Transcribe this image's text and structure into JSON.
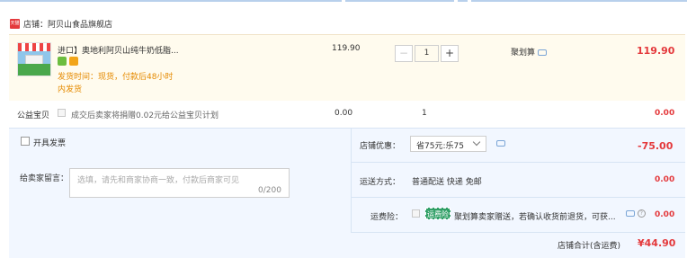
{
  "shop": {
    "badge": "天猫",
    "label": "店铺：阿贝山食品旗舰店"
  },
  "item": {
    "title": "进口】奥地利阿贝山纯牛奶低脂...",
    "ship_note_line1": "发货时间：现货，付款后48小时",
    "ship_note_line2": "内发货",
    "unit_price": "119.90",
    "quantity": "1",
    "promo": "聚划算",
    "total": "119.90"
  },
  "charity": {
    "label": "公益宝贝",
    "text": "成交后卖家将捐赠0.02元给公益宝贝计划",
    "price": "0.00",
    "qty": "1",
    "total": "0.00"
  },
  "order": {
    "invoice_label": "开具发票",
    "memo_label": "给卖家留言：",
    "memo_placeholder": "选填，请先和商家协商一致，付款后商家可见",
    "memo_count": "0/200",
    "shop_discount_label": "店铺优惠：",
    "shop_discount_value": "省75元:乐75",
    "shop_discount_amount": "-75.00",
    "shipping_label": "运送方式：",
    "shipping_value": "普通配送 快递 免邮",
    "shipping_amount": "0.00",
    "insurance_label": "运费险：",
    "insurance_badge": "运费险",
    "insurance_text": "聚划算卖家赠送，若确认收货前退货，可获...",
    "insurance_amount": "0.00",
    "help_glyph": "?",
    "grand_label": "店铺合计(含运费)",
    "grand_total": "¥44.90"
  },
  "colors": {
    "price_red": "#e4393c",
    "item_bg": "#fffbee",
    "panel_bg": "#f2f7ff"
  }
}
